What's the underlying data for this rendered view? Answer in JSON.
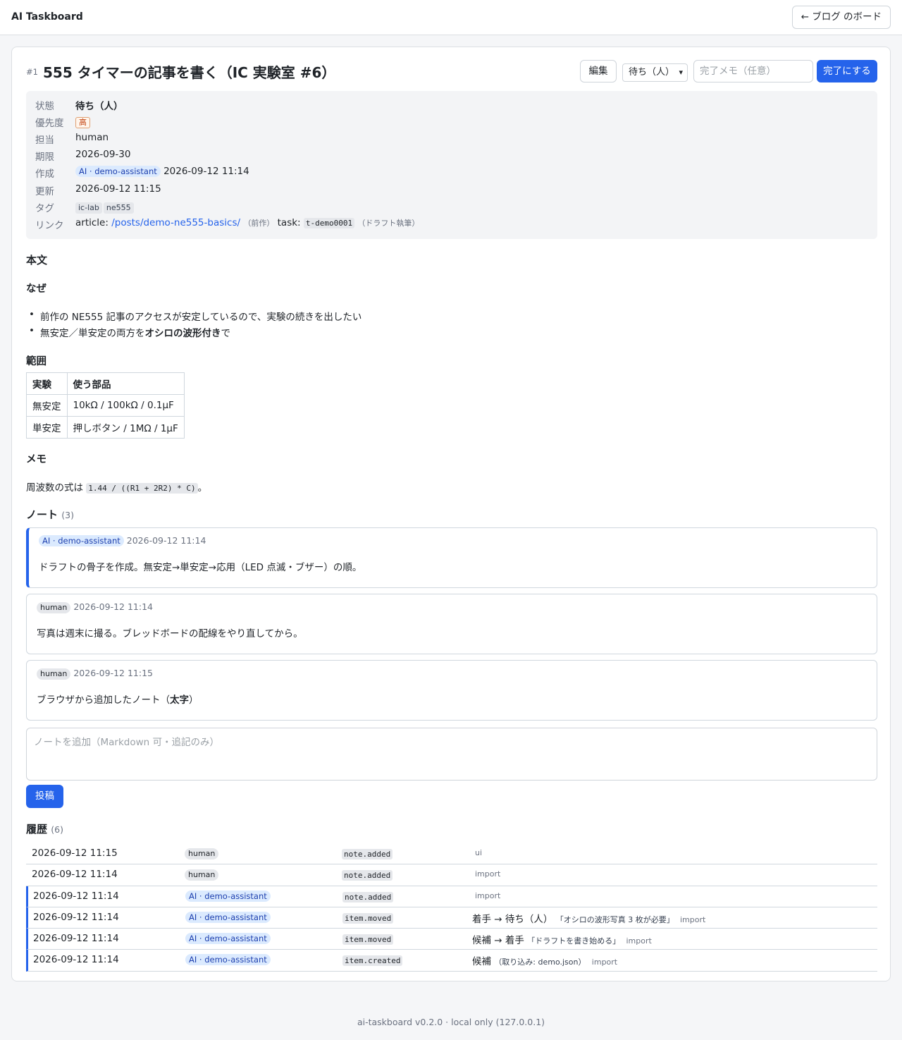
{
  "app": {
    "brand": "AI Taskboard",
    "back_label": "← ブログ のボード"
  },
  "task": {
    "id_label": "#1",
    "title": "555 タイマーの記事を書く（IC 実験室 #6）",
    "edit_label": "編集",
    "status_selected": "待ち（人）",
    "memo_placeholder": "完了メモ（任意）",
    "complete_label": "完了にする"
  },
  "meta": {
    "status_key": "状態",
    "status_val": "待ち（人）",
    "priority_key": "優先度",
    "priority_val": "高",
    "assignee_key": "担当",
    "assignee_val": "human",
    "due_key": "期限",
    "due_val": "2026-09-30",
    "created_key": "作成",
    "created_actor": "AI · demo-assistant",
    "created_time": "2026-09-12 11:14",
    "updated_key": "更新",
    "updated_val": "2026-09-12 11:15",
    "tags_key": "タグ",
    "tags": [
      "ic-lab",
      "ne555"
    ],
    "links_key": "リンク",
    "link_article_label": "article:",
    "link_article_url": "/posts/demo-ne555-basics/",
    "link_article_note": "（前作）",
    "link_task_label": "task:",
    "link_task_id": "t-demo0001",
    "link_task_note": "（ドラフト執筆）"
  },
  "body": {
    "heading": "本文",
    "why_heading": "なぜ",
    "why_items": [
      "前作の NE555 記事のアクセスが安定しているので、実験の続きを出したい"
    ],
    "why_item2_prefix": "無安定／単安定の両方を",
    "why_item2_bold": "オシロの波形付き",
    "why_item2_suffix": "で",
    "scope_heading": "範囲",
    "table_headers": [
      "実験",
      "使う部品"
    ],
    "table_rows": [
      [
        "無安定",
        "10kΩ / 100kΩ / 0.1μF"
      ],
      [
        "単安定",
        "押しボタン / 1MΩ / 1μF"
      ]
    ],
    "memo_heading": "メモ",
    "memo_prefix": "周波数の式は",
    "memo_code": "1.44 / ((R1 + 2R2) * C)",
    "memo_suffix": "。"
  },
  "notes": {
    "heading": "ノート",
    "count": "(3)",
    "items": [
      {
        "actor": "AI · demo-assistant",
        "time": "2026-09-12 11:14",
        "body": "ドラフトの骨子を作成。無安定→単安定→応用（LED 点滅・ブザー）の順。"
      },
      {
        "actor": "human",
        "time": "2026-09-12 11:14",
        "body": "写真は週末に撮る。ブレッドボードの配線をやり直してから。"
      },
      {
        "actor": "human",
        "time": "2026-09-12 11:15",
        "body_prefix": "ブラウザから追加したノート（",
        "body_bold": "太字",
        "body_suffix": "）"
      }
    ],
    "input_placeholder": "ノートを追加（Markdown 可・追記のみ）",
    "post_label": "投稿"
  },
  "history": {
    "heading": "履歴",
    "count": "(6)",
    "rows": [
      {
        "time": "2026-09-12 11:15",
        "actor": "human",
        "kind": "note.added",
        "detail": "",
        "reason": "",
        "source": "ui"
      },
      {
        "time": "2026-09-12 11:14",
        "actor": "human",
        "kind": "note.added",
        "detail": "",
        "reason": "",
        "source": "import"
      },
      {
        "time": "2026-09-12 11:14",
        "actor": "AI · demo-assistant",
        "kind": "note.added",
        "detail": "",
        "reason": "",
        "source": "import"
      },
      {
        "time": "2026-09-12 11:14",
        "actor": "AI · demo-assistant",
        "kind": "item.moved",
        "detail": "着手 → 待ち（人）",
        "reason": "「オシロの波形写真 3 枚が必要」",
        "source": "import"
      },
      {
        "time": "2026-09-12 11:14",
        "actor": "AI · demo-assistant",
        "kind": "item.moved",
        "detail": "候補 → 着手",
        "reason": "「ドラフトを書き始める」",
        "source": "import"
      },
      {
        "time": "2026-09-12 11:14",
        "actor": "AI · demo-assistant",
        "kind": "item.created",
        "detail": "候補",
        "reason": "（取り込み: demo.json）",
        "source": "import"
      }
    ]
  },
  "footer": "ai-taskboard v0.2.0 · local only (127.0.0.1)",
  "colors": {
    "accent": "#2563eb",
    "ai_badge_bg": "#dbeafe",
    "priority_high": "#c2410c"
  }
}
